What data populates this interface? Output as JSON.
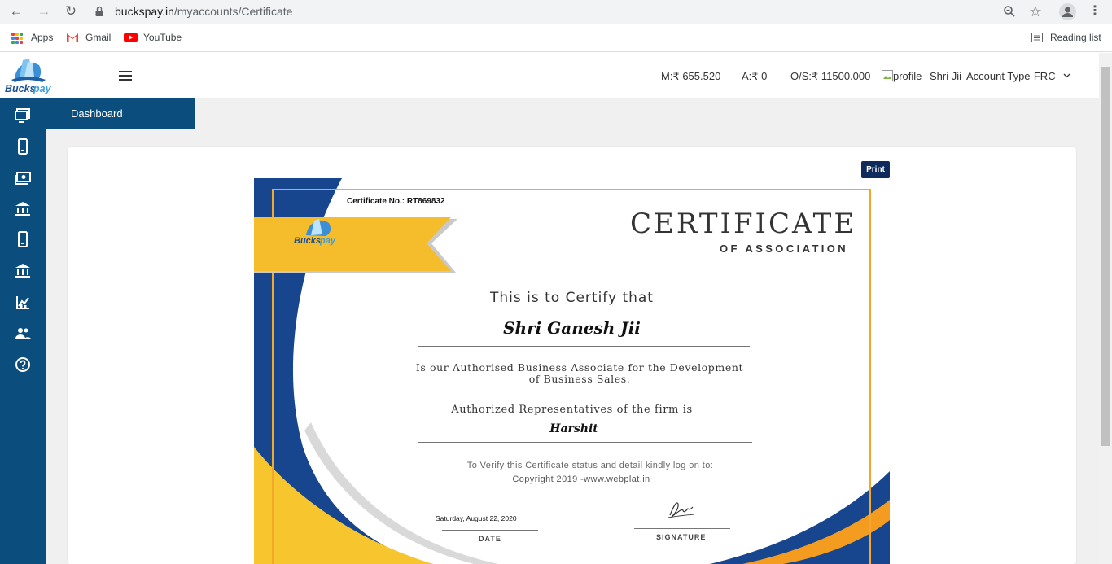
{
  "browser": {
    "url_host": "buckspay.in",
    "url_path": "/myaccounts/Certificate",
    "bookmarks": [
      "Apps",
      "Gmail",
      "YouTube"
    ],
    "reading_list": "Reading list"
  },
  "header": {
    "main_balance": "M:₹ 655.520",
    "a_balance": "A:₹ 0",
    "outstanding": "O/S:₹ 11500.000",
    "profile_alt": "profile",
    "user_name": "Shri Jii",
    "account_type": "Account Type-FRC"
  },
  "sidebar": {
    "dashboard_label": "Dashboard",
    "icons": [
      "monitor-icon",
      "mobile-icon",
      "money-icon",
      "bank-icon",
      "mobile-icon",
      "bank-icon",
      "chart-icon",
      "users-icon",
      "help-icon"
    ]
  },
  "main": {
    "print_label": "Print"
  },
  "certificate": {
    "number": "Certificate No.: RT869832",
    "brand": "Buckspay",
    "title": "CERTIFICATE",
    "subtitle": "OF ASSOCIATION",
    "certify_line": "This is to Certify that",
    "holder_name": "Shri Ganesh Jii",
    "association_text": "Is our Authorised Business Associate for the Development of Business Sales.",
    "representative_line": "Authorized Representatives of the firm is",
    "representative_name": "Harshit",
    "verify_text": "To Verify this Certificate status and detail kindly log on to:",
    "copyright": "Copyright 2019 -www.webplat.in",
    "date_value": "Saturday, August 22, 2020",
    "date_label": "DATE",
    "signature_label": "SIGNATURE"
  },
  "colors": {
    "sidebar": "#0b4e7e",
    "print_button": "#0f2b5c",
    "cert_blue": "#17468f",
    "cert_yellow": "#f7c62f",
    "cert_orange": "#f39c1f"
  }
}
